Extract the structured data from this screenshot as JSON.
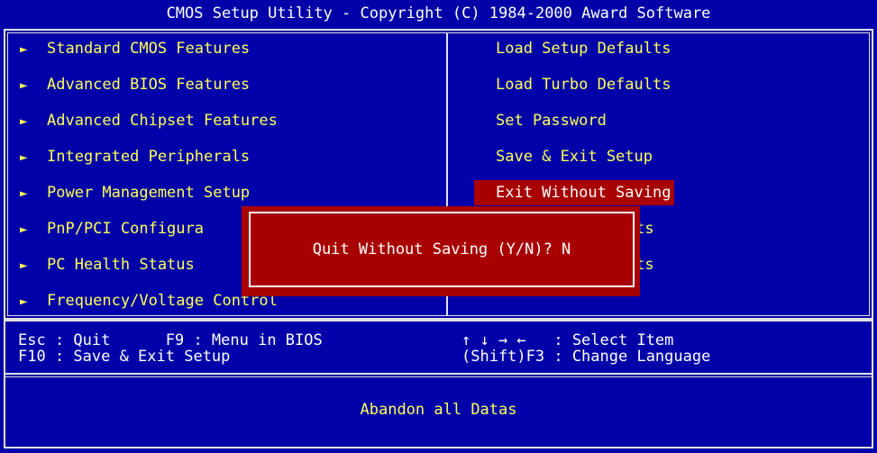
{
  "title": "CMOS Setup Utility - Copyright (C) 1984-2000 Award Software",
  "left_menu": [
    {
      "label": "Standard CMOS Features",
      "marker": "►"
    },
    {
      "label": "Advanced BIOS Features",
      "marker": "►"
    },
    {
      "label": "Advanced Chipset Features",
      "marker": "►"
    },
    {
      "label": "Integrated Peripherals",
      "marker": "►"
    },
    {
      "label": "Power Management Setup",
      "marker": "►"
    },
    {
      "label": "PnP/PCI Configura",
      "marker": "►"
    },
    {
      "label": "PC Health Status",
      "marker": "►"
    },
    {
      "label": "Frequency/Voltage Control",
      "marker": "►"
    }
  ],
  "right_menu": [
    {
      "label": "Load Setup Defaults"
    },
    {
      "label": "Load Turbo Defaults"
    },
    {
      "label": "Set Password"
    },
    {
      "label": "Save & Exit Setup"
    },
    {
      "label": "Exit Without Saving"
    },
    {
      "label": "efaults"
    },
    {
      "label": "efaults"
    }
  ],
  "selected_right_index": 4,
  "help": {
    "line1_left": "Esc : Quit      F9 : Menu in BIOS",
    "line2_left": "F10 : Save & Exit Setup",
    "line1_right": "↑ ↓ → ←   : Select Item",
    "line2_right": "(Shift)F3 : Change Language"
  },
  "status_text": "Abandon all Datas",
  "dialog": {
    "prompt": "Quit Without Saving (Y/N)? N"
  },
  "colors": {
    "background": "#0000A8",
    "menu_text": "#FFFF55",
    "highlight": "#A80000",
    "border": "#E0E0E0"
  }
}
